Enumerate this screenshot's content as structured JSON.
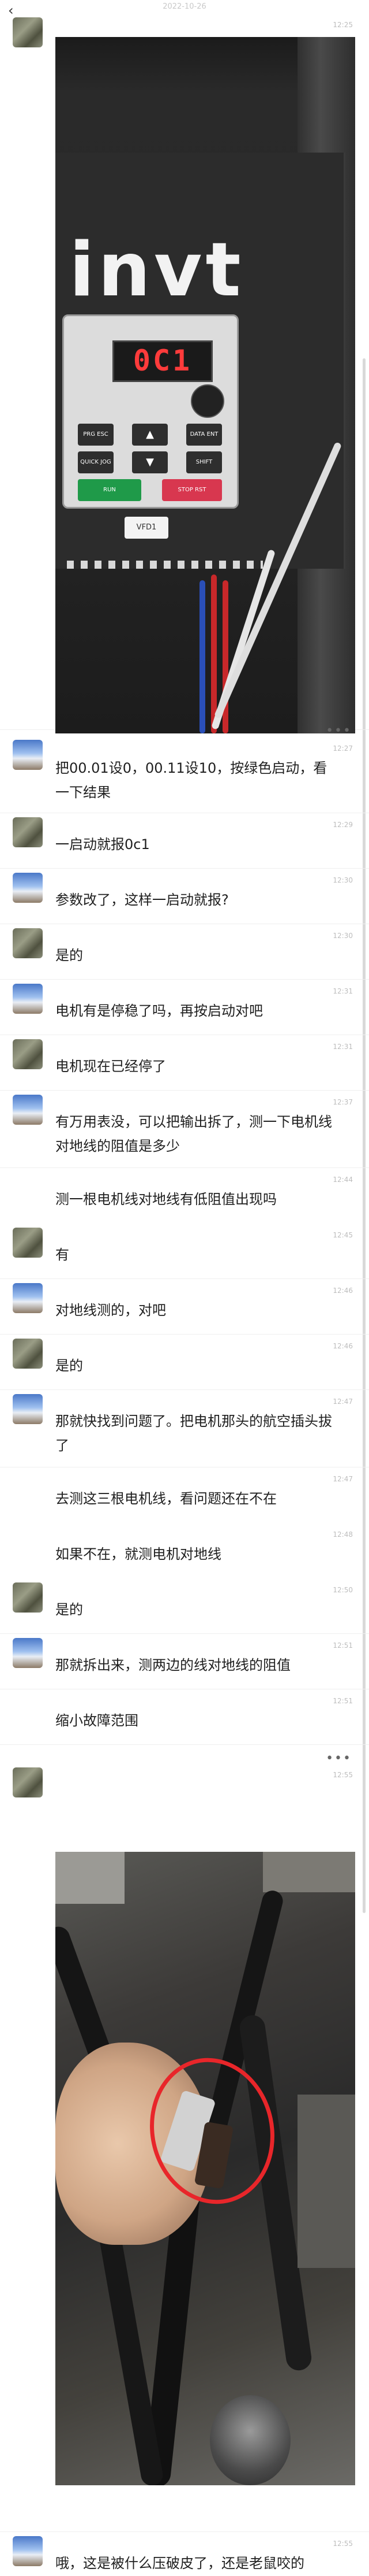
{
  "header": {
    "back_icon": "‹",
    "date": "2022-10-26"
  },
  "messages": [
    {
      "id": "m1",
      "sender": "a",
      "time": "12:25",
      "type": "image",
      "photo": {
        "logo": "invt",
        "display": "0C1",
        "tag": "VFD1",
        "keys": [
          "PRG ESC",
          "▲",
          "DATA ENT",
          "QUICK JOG",
          "▼",
          "SHIFT",
          "RUN",
          "STOP RST"
        ]
      }
    },
    {
      "id": "m2",
      "sender": "b",
      "time": "12:27",
      "type": "text",
      "text": "把00.01设0，00.11设10，按绿色启动，看一下结果"
    },
    {
      "id": "m3",
      "sender": "a",
      "time": "12:29",
      "type": "text",
      "text": "一启动就报0c1"
    },
    {
      "id": "m4",
      "sender": "b",
      "time": "12:30",
      "type": "text",
      "text": "参数改了，这样一启动就报?"
    },
    {
      "id": "m5",
      "sender": "a",
      "time": "12:30",
      "type": "text",
      "text": "是的"
    },
    {
      "id": "m6",
      "sender": "b",
      "time": "12:31",
      "type": "text",
      "text": "电机有是停稳了吗，再按启动对吧"
    },
    {
      "id": "m7",
      "sender": "a",
      "time": "12:31",
      "type": "text",
      "text": "电机现在已经停了"
    },
    {
      "id": "m8",
      "sender": "b",
      "time": "12:37",
      "type": "text",
      "text": "有万用表没，可以把输出拆了，测一下电机线对地线的阻值是多少"
    },
    {
      "id": "m9",
      "sender": "b",
      "time": "12:44",
      "type": "text",
      "text": "测一根电机线对地线有低阻值出现吗"
    },
    {
      "id": "m10",
      "sender": "a",
      "time": "12:45",
      "type": "text",
      "text": "有"
    },
    {
      "id": "m11",
      "sender": "b",
      "time": "12:46",
      "type": "text",
      "text": "对地线测的，对吧"
    },
    {
      "id": "m12",
      "sender": "a",
      "time": "12:46",
      "type": "text",
      "text": "是的"
    },
    {
      "id": "m13",
      "sender": "b",
      "time": "12:47",
      "type": "text",
      "text": "那就快找到问题了。把电机那头的航空插头拔了"
    },
    {
      "id": "m14",
      "sender": "b",
      "time": "12:47",
      "type": "text",
      "text": "去测这三根电机线，看问题还在不在"
    },
    {
      "id": "m15",
      "sender": "b",
      "time": "12:48",
      "type": "text",
      "text": "如果不在，就测电机对地线"
    },
    {
      "id": "m16",
      "sender": "a",
      "time": "12:50",
      "type": "text",
      "text": "是的"
    },
    {
      "id": "m17",
      "sender": "b",
      "time": "12:51",
      "type": "text",
      "text": "那就拆出来，测两边的线对地线的阻值"
    },
    {
      "id": "m18",
      "sender": "b",
      "time": "12:51",
      "type": "text",
      "text": "缩小故障范围"
    },
    {
      "id": "m19",
      "sender": "a",
      "time": "12:55",
      "type": "image",
      "photo": {}
    },
    {
      "id": "m20",
      "sender": "b",
      "time": "12:55",
      "type": "text",
      "text": "哦，这是被什么压破皮了，还是老鼠咬的"
    }
  ],
  "more_icon": "•••"
}
